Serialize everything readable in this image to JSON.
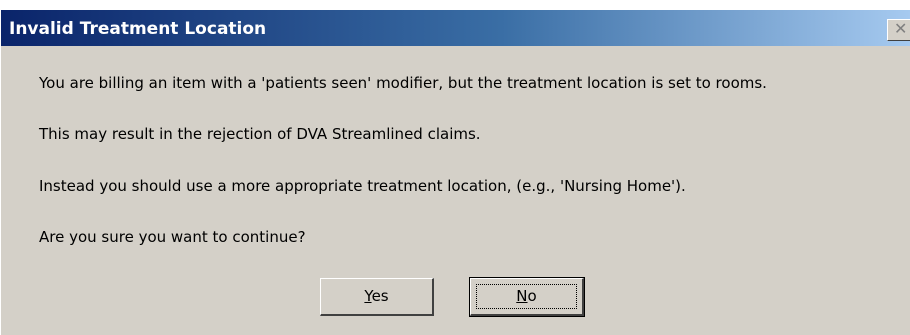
{
  "dialog": {
    "title": "Invalid Treatment Location",
    "close_glyph": "✕",
    "messages": [
      "You are billing an item with a 'patients seen' modifier, but the treatment location is set to rooms.",
      "This may result in the rejection of DVA Streamlined claims.",
      "Instead you should use a more appropriate treatment location, (e.g., 'Nursing Home').",
      "Are you sure you want to continue?"
    ],
    "buttons": {
      "yes": {
        "mnemonic": "Y",
        "rest": "es"
      },
      "no": {
        "mnemonic": "N",
        "rest": "o"
      }
    }
  }
}
